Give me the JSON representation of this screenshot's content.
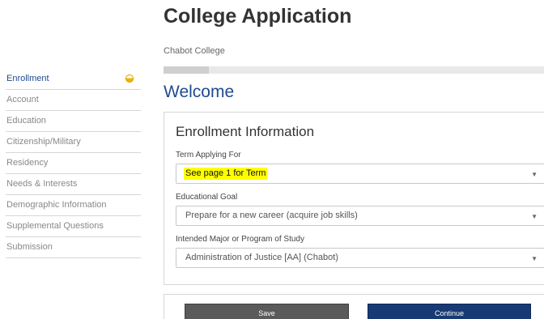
{
  "header": {
    "title": "College Application",
    "college": "Chabot College",
    "progress_fraction": 0.12
  },
  "sidebar": {
    "items": [
      {
        "label": "Enrollment",
        "status": "half-complete-circle-icon"
      },
      {
        "label": "Account"
      },
      {
        "label": "Education"
      },
      {
        "label": "Citizenship/Military"
      },
      {
        "label": "Residency"
      },
      {
        "label": "Needs & Interests"
      },
      {
        "label": "Demographic Information"
      },
      {
        "label": "Supplemental Questions"
      },
      {
        "label": "Submission"
      }
    ]
  },
  "main": {
    "welcome": "Welcome",
    "section_title": "Enrollment Information",
    "fields": [
      {
        "label": "Term Applying For",
        "value": "See page 1 for Term",
        "highlight": "#ffff00"
      },
      {
        "label": "Educational Goal",
        "value": "Prepare for a new career (acquire job skills)"
      },
      {
        "label": "Intended Major or Program of Study",
        "value": "Administration of Justice [AA] (Chabot)"
      }
    ]
  },
  "actions": {
    "save_label": "Save",
    "continue_label": "Continue"
  },
  "colors": {
    "accent": "#1f4b8e",
    "continue_button": "#173a74",
    "save_button": "#5a5a5a",
    "status_icon": "#f2b400"
  },
  "icons": {
    "dropdown": "chevron-down-icon",
    "status": "half-complete-circle-icon"
  }
}
